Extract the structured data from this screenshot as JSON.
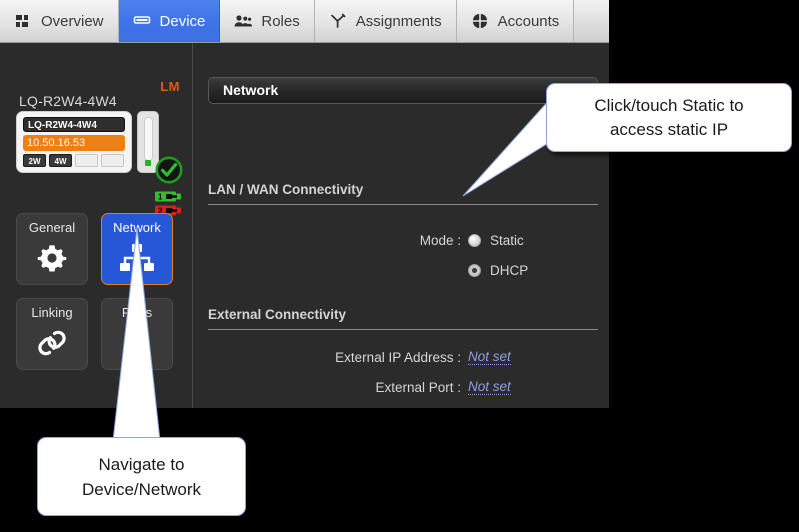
{
  "tabs": [
    {
      "label": "Overview",
      "icon": "grid-icon",
      "active": false
    },
    {
      "label": "Device",
      "icon": "monitor-icon",
      "active": true
    },
    {
      "label": "Roles",
      "icon": "people-icon",
      "active": false
    },
    {
      "label": "Assignments",
      "icon": "branch-icon",
      "active": false
    },
    {
      "label": "Accounts",
      "icon": "pie-circle-icon",
      "active": false
    }
  ],
  "sidebar": {
    "device_name": "LQ-R2W4-4W4",
    "lm_badge": "LM",
    "device_card": {
      "title": "LQ-R2W4-4W4",
      "ip_address": "10.50.16.53",
      "ports": [
        {
          "label": "2W",
          "state": "on"
        },
        {
          "label": "4W",
          "state": "on"
        },
        {
          "label": "",
          "state": "off"
        },
        {
          "label": "",
          "state": "off"
        }
      ],
      "status_icon": "green-check-icon",
      "connectors": [
        {
          "label": "1",
          "color": "#2fbe2f"
        },
        {
          "label": "2",
          "color": "#d82020"
        }
      ]
    },
    "tiles": [
      {
        "label": "General",
        "icon": "gear-icon",
        "active": false
      },
      {
        "label": "Network",
        "icon": "network-icon",
        "active": true
      },
      {
        "label": "Linking",
        "icon": "link-icon",
        "active": false
      },
      {
        "label": "Ports",
        "icon": "play-icon",
        "active": false
      }
    ]
  },
  "content": {
    "panel_title": "Network",
    "sections": [
      {
        "title": "LAN / WAN Connectivity",
        "mode_label": "Mode :",
        "options": [
          {
            "label": "Static",
            "selected": false
          },
          {
            "label": "DHCP",
            "selected": true
          }
        ]
      },
      {
        "title": "External Connectivity",
        "fields": [
          {
            "label": "External IP Address :",
            "value": "Not set"
          },
          {
            "label": "External Port :",
            "value": "Not set"
          }
        ]
      }
    ]
  },
  "callouts": [
    {
      "line1": "Click/touch Static to",
      "line2": "access static IP"
    },
    {
      "line1": "Navigate to",
      "line2": "Device/Network"
    }
  ],
  "colors": {
    "accent_blue": "#3f74e8",
    "tile_active_blue": "#2657d6",
    "tile_active_border": "#e07e2a",
    "orange_ip": "#ee8013",
    "lm_orange": "#e2590f",
    "link_blue": "#8e9fe8",
    "callout_border": "#8fa8dd",
    "status_green": "#2fbe2f",
    "connector_red": "#d82020"
  }
}
